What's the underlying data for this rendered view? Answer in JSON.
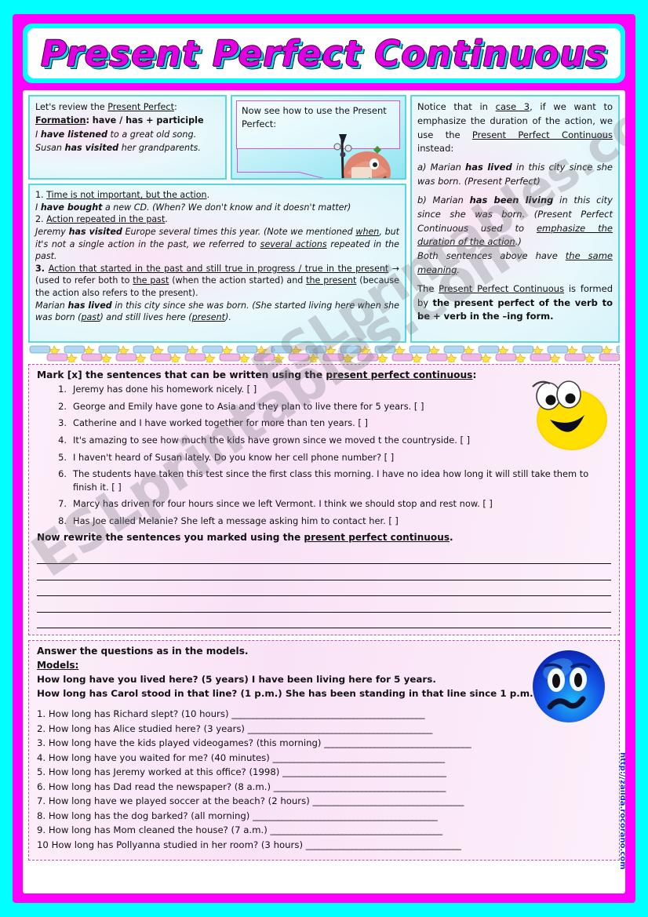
{
  "title": "Present Perfect Continuous",
  "watermark": {
    "text": "ESLprintables.com",
    "text2": "ESLprintables.com"
  },
  "vertical_url": "http://zailda.rocorano.com",
  "colors": {
    "outer_border": "#00FFFF",
    "frame": "#FF00FF",
    "title_text": "#E000E0",
    "title_shadow": "#00E5E5",
    "box_border": "#58D7E0",
    "exercise_border": "#C050A8",
    "url_text": "#1030E0"
  },
  "grammar": {
    "review_box": {
      "line1_pre": "Let's review the ",
      "line1_u": "Present Perfect",
      "line1_post": ":",
      "line2_label": "Formation",
      "line2_rest": ": have / has + participle",
      "example1_a": "I ",
      "example1_b": "have listened",
      "example1_c": " to a great old song.",
      "example2_a": "Susan ",
      "example2_b": "has visited",
      "example2_c": " her grandparents."
    },
    "bubble": {
      "text": "Now see how to use the Present Perfect:"
    },
    "cases_box": {
      "case1_num": "1. ",
      "case1_title": "Time is not important, but the action",
      "case1_dot": ".",
      "case1_ex_a": "I ",
      "case1_ex_b": "have bought",
      "case1_ex_c": " a new CD. (When? We don't know and it doesn't matter)",
      "case2_num": "2.  ",
      "case2_title": "Action repeated in the past",
      "case2_dot": ".",
      "case2_ex_a": "Jeremy ",
      "case2_ex_b": "has visited",
      "case2_ex_c": " Europe several times this year. (Note we mentioned ",
      "case2_ex_u1": "when",
      "case2_ex_d": ", but it's not a single action in the past, we referred to ",
      "case2_ex_u2": "several actions",
      "case2_ex_e": " repeated in the past.",
      "case3_num": " 3. ",
      "case3_title": "Action that started in the past and still true in progress / true in the present",
      "case3_arrow": " → ",
      "case3_a": "(used to refer both to ",
      "case3_u1": "the past",
      "case3_b": " (when the action started) and ",
      "case3_u2": "the present",
      "case3_c": " (because the action also refers to the present).",
      "case3_ex_a": "Marian ",
      "case3_ex_b": "has lived",
      "case3_ex_c": " in this city since she was born. (She started living here when she was born (",
      "case3_ex_u1": "past",
      "case3_ex_d": ") and still lives here (",
      "case3_ex_u2": "present",
      "case3_ex_e": ")."
    },
    "notice_box": {
      "p1_a": "Notice that in ",
      "p1_u1": "case 3",
      "p1_b": ", if we want to emphasize the duration of the action, we use the ",
      "p1_u2": "Present Perfect Continuous",
      "p1_c": " instead:",
      "a_label": "a) Marian ",
      "a_bold": "has lived",
      "a_rest": " in this city since she was born. (Present Perfect)",
      "b_label": "b) Marian ",
      "b_bold": "has been living",
      "b_rest1": " in this city since she was born. (Present Perfect Continuous used to ",
      "b_u": "emphasize the duration of the action",
      "b_rest2": ".)",
      "both_a": "Both sentences above have ",
      "both_u": "the same meaning",
      "both_b": ".",
      "formed_a": "The ",
      "formed_u": "Present Perfect Continuous",
      "formed_b": " is formed by ",
      "formed_bold": "the present perfect of the verb to be + verb in the –ing form."
    }
  },
  "exercise1": {
    "instruction_a": "Mark [x] the sentences that can be written using the ",
    "instruction_u": "present perfect continuous",
    "instruction_b": ":",
    "sentences": [
      {
        "num": "1.",
        "text": "Jeremy has done his homework nicely. [   ]"
      },
      {
        "num": "2.",
        "text": "George and Emily have gone to Asia and they plan to live there for 5 years. [   ]"
      },
      {
        "num": "3.",
        "text": "Catherine and I have worked together for more than ten years. [  ]"
      },
      {
        "num": "4.",
        "text": "It's amazing to see how much the kids have grown since we moved t the countryside. [   ]"
      },
      {
        "num": "5.",
        "text": "I haven't heard of Susan lately. Do you know her cell phone number? [   ]"
      },
      {
        "num": "6.",
        "text": "The students have taken this test since the first class this morning. I have no idea how long it will still take them to finish it. [  ]"
      },
      {
        "num": "7.",
        "text": "Marcy has driven for four hours since we left Vermont. I think we should stop and rest now. [   ]"
      },
      {
        "num": "8.",
        "text": "Has Joe called Melanie? She left a message asking him to contact her. [  ]"
      }
    ],
    "rewrite_a": "Now rewrite the sentences you marked using the ",
    "rewrite_u": "present perfect continuous",
    "rewrite_b": ".",
    "blank_line_count": 5
  },
  "exercise2": {
    "instruction": "Answer the questions as in the models.",
    "models_label": "Models:",
    "model1": "How long have you lived here? (5 years) I have been living here for 5 years.",
    "model2": "How long has Carol stood in that line? (1 p.m.) She has been standing in that line since 1 p.m.",
    "questions": [
      {
        "num": "1.",
        "text": "How long has Richard slept? (10 hours)",
        "rule": "______________________________________________"
      },
      {
        "num": "2.",
        "text": "How long has Alice studied here? (3 years)",
        "rule": "____________________________________________"
      },
      {
        "num": "3.",
        "text": "How long have the kids played videogames? (this morning)",
        "rule": "___________________________________"
      },
      {
        "num": "4.",
        "text": "How long have you waited for me? (40 minutes)",
        "rule": "_________________________________________"
      },
      {
        "num": "5.",
        "text": "How long has Jeremy worked at this office? (1998)",
        "rule": "_______________________________________"
      },
      {
        "num": "6.",
        "text": "How long has Dad read the newspaper? (8 a.m.)",
        "rule": "_________________________________________"
      },
      {
        "num": "7.",
        "text": "How long have we played soccer at the beach? (2 hours)",
        "rule": "____________________________________"
      },
      {
        "num": "8.",
        "text": "How long has the dog barked? (all morning)",
        "rule": "____________________________________________"
      },
      {
        "num": "9.",
        "text": "How long has Mom cleaned the house? (7 a.m.)",
        "rule": "_________________________________________"
      },
      {
        "num": "10",
        "text": "How long has Pollyanna studied in her room? (3 hours)",
        "rule": "_____________________________________"
      }
    ]
  },
  "icons": {
    "character": "tiki-character-icon",
    "smiley_yellow": "happy-face-icon",
    "smiley_blue": "confused-face-icon"
  }
}
